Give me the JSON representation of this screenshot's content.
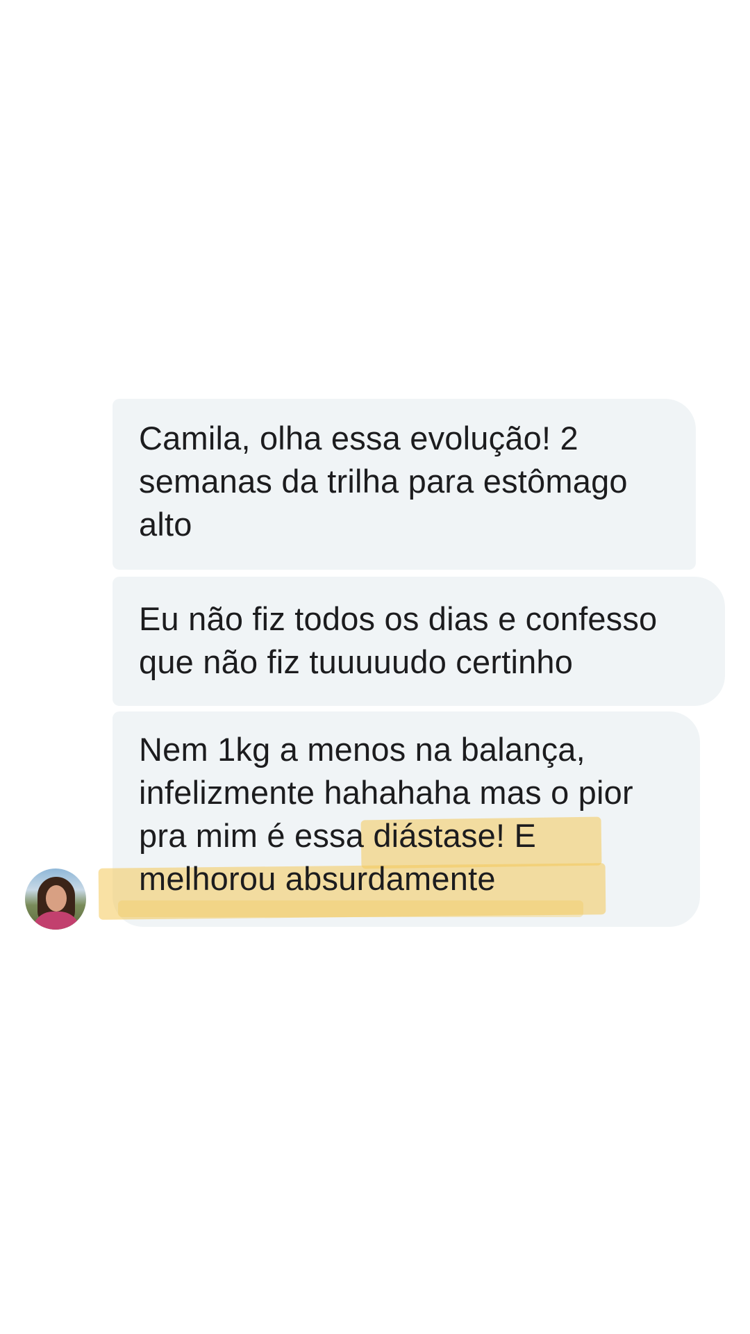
{
  "messages": [
    {
      "lines": [
        "Camila, olha essa evolução! 2",
        "semanas da trilha para estômago",
        "alto"
      ]
    },
    {
      "lines": [
        "Eu não fiz todos os dias e confesso",
        "que não fiz tuuuuudo certinho"
      ]
    },
    {
      "lines": [
        "Nem 1kg a menos na balança,",
        "infelizmente hahahaha mas o pior",
        "pra mim é essa diástase! E",
        "melhorou absurdamente"
      ]
    }
  ],
  "colors": {
    "bubble_background": "#f0f4f6",
    "highlight": "#f4c85a",
    "text": "#1c1c1e"
  },
  "sender": {
    "avatar_icon": "profile-photo"
  }
}
